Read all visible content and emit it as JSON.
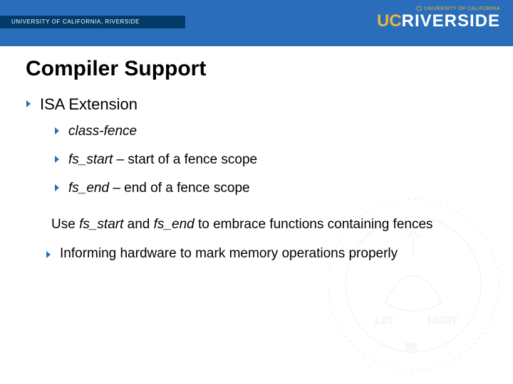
{
  "header": {
    "institution_bar": "UNIVERSITY OF CALIFORNIA, RIVERSIDE",
    "logo_small": "UNIVERSITY OF CALIFORNIA",
    "logo_uc": "UC",
    "logo_riverside": "RIVERSIDE"
  },
  "title": "Compiler Support",
  "bullets": {
    "isa_extension": "ISA Extension",
    "sub": [
      {
        "italic": "class-fence",
        "rest": ""
      },
      {
        "italic": "fs_start",
        "rest": " – start of a fence scope"
      },
      {
        "italic": "fs_end",
        "rest": " – end of a fence scope"
      }
    ]
  },
  "para": {
    "pre": "Use ",
    "i1": "fs_start",
    "mid": " and ",
    "i2": "fs_end",
    "post": " to embrace functions containing fences"
  },
  "informing": "Informing hardware to mark memory operations properly"
}
